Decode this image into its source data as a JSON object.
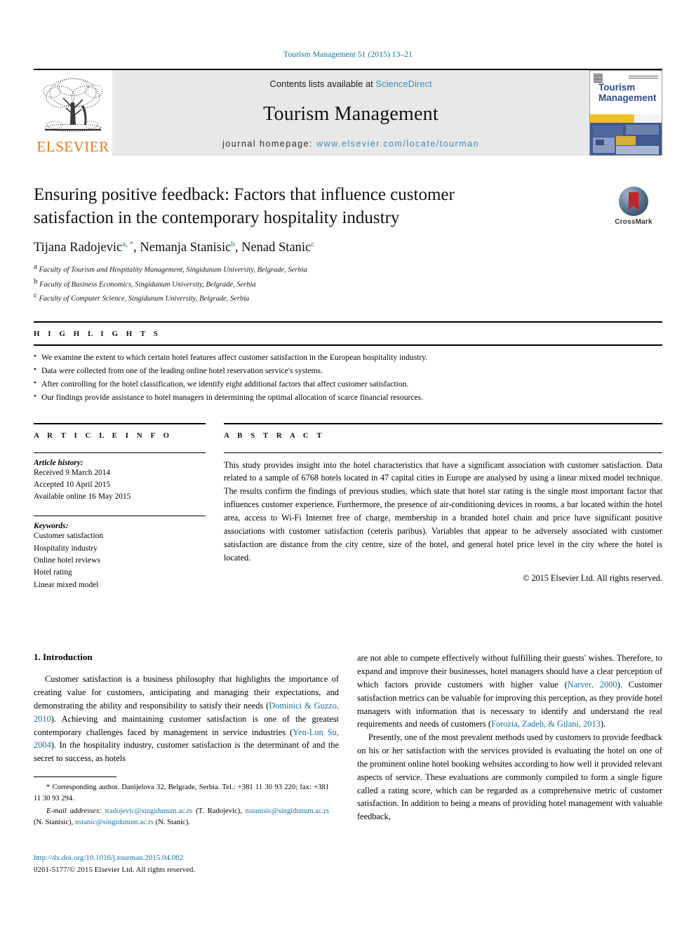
{
  "running_head": "Tourism Management 51 (2015) 13–21",
  "masthead": {
    "publisher_name": "ELSEVIER",
    "contents_prefix": "Contents lists available at ",
    "contents_link": "ScienceDirect",
    "journal_name": "Tourism Management",
    "homepage_prefix": "journal homepage: ",
    "homepage_url": "www.elsevier.com/locate/tourman",
    "cover_title": "Tourism Management"
  },
  "crossmark": {
    "label": "CrossMark"
  },
  "article": {
    "title": "Ensuring positive feedback: Factors that influence customer satisfaction in the contemporary hospitality industry",
    "authors": [
      {
        "name": "Tijana Radojevic",
        "marks": "a, *"
      },
      {
        "name": "Nemanja Stanisic",
        "marks": "b"
      },
      {
        "name": "Nenad Stanic",
        "marks": "c"
      }
    ],
    "affiliations": [
      {
        "mark": "a",
        "text": "Faculty of Tourism and Hospitality Management, Singidunum University, Belgrade, Serbia"
      },
      {
        "mark": "b",
        "text": "Faculty of Business Economics, Singidunum University, Belgrade, Serbia"
      },
      {
        "mark": "c",
        "text": "Faculty of Computer Science, Singidunum University, Belgrade, Serbia"
      }
    ]
  },
  "highlights": {
    "heading": "H I G H L I G H T S",
    "items": [
      "We examine the extent to which certain hotel features affect customer satisfaction in the European hospitality industry.",
      "Data were collected from one of the leading online hotel reservation service's systems.",
      "After controlling for the hotel classification, we identify eight additional factors that affect customer satisfaction.",
      "Our findings provide assistance to hotel managers in determining the optimal allocation of scarce financial resources."
    ]
  },
  "article_info": {
    "heading": "A R T I C L E   I N F O",
    "history_label": "Article history:",
    "history": [
      "Received 9 March 2014",
      "Accepted 10 April 2015",
      "Available online 16 May 2015"
    ],
    "keywords_label": "Keywords:",
    "keywords": [
      "Customer satisfaction",
      "Hospitality industry",
      "Online hotel reviews",
      "Hotel rating",
      "Linear mixed model"
    ]
  },
  "abstract": {
    "heading": "A B S T R A C T",
    "text": "This study provides insight into the hotel characteristics that have a significant association with customer satisfaction. Data related to a sample of 6768 hotels located in 47 capital cities in Europe are analysed by using a linear mixed model technique. The results confirm the findings of previous studies, which state that hotel star rating is the single most important factor that influences customer experience. Furthermore, the presence of air-conditioning devices in rooms, a bar located within the hotel area, access to Wi-Fi Internet free of charge, membership in a branded hotel chain and price have significant positive associations with customer satisfaction (ceteris paribus). Variables that appear to be adversely associated with customer satisfaction are distance from the city centre, size of the hotel, and general hotel price level in the city where the hotel is located.",
    "copyright": "© 2015 Elsevier Ltd. All rights reserved."
  },
  "introduction": {
    "heading": "1. Introduction",
    "left_paragraph_part1": "Customer satisfaction is a business philosophy that highlights the importance of creating value for customers, anticipating and managing their expectations, and demonstrating the ability and responsibility to satisfy their needs (",
    "left_cite1": "Dominici & Guzzo, 2010",
    "left_paragraph_part2": "). Achieving and maintaining customer satisfaction is one of the greatest contemporary challenges faced by management in service industries (",
    "left_cite2": "Yen-Lun Su, 2004",
    "left_paragraph_part3": "). In the hospitality industry, customer satisfaction is the determinant of and the secret to success, as hotels",
    "right_p1_part1": "are not able to compete effectively without fulfilling their guests' wishes. Therefore, to expand and improve their businesses, hotel managers should have a clear perception of which factors provide customers with higher value (",
    "right_cite1": "Narver, 2000",
    "right_p1_part2": "). Customer satisfaction metrics can be valuable for improving this perception, as they provide hotel managers with information that is necessary to identify and understand the real requirements and needs of customers (",
    "right_cite2": "Forozia, Zadeh, & Gilani, 2013",
    "right_p1_part3": ").",
    "right_p2": "Presently, one of the most prevalent methods used by customers to provide feedback on his or her satisfaction with the services provided is evaluating the hotel on one of the prominent online hotel booking websites according to how well it provided relevant aspects of service. These evaluations are commonly compiled to form a single figure called a rating score, which can be regarded as a comprehensive metric of customer satisfaction. In addition to being a means of providing hotel management with valuable feedback,"
  },
  "footnote": {
    "corresponding": "* Corresponding author. Danijelova 32, Belgrade, Serbia. Tel.: +381 11 30 93 220; fax: +381 11 30 93 294.",
    "email_label": "E-mail addresses:",
    "emails": [
      {
        "address": "tradojevic@singidunum.ac.rs",
        "owner": "(T. Radojevic)"
      },
      {
        "address": "nstanisic@singidunum.ac.rs",
        "owner": "(N. Stanisic)"
      },
      {
        "address": "nstanic@singidunum.ac.rs",
        "owner": "(N. Stanic)"
      }
    ]
  },
  "doi_block": {
    "doi": "http://dx.doi.org/10.1016/j.tourman.2015.04.002",
    "issn": "0261-5177/© 2015 Elsevier Ltd. All rights reserved."
  },
  "colors": {
    "link_blue": "#1a6fa3",
    "sciencedirect_blue": "#3a8fc0",
    "elsevier_orange": "#e87722",
    "crossmark_red": "#c0252b",
    "cover_blue": "#2b4d8e",
    "cover_yellow": "#f0c020"
  }
}
